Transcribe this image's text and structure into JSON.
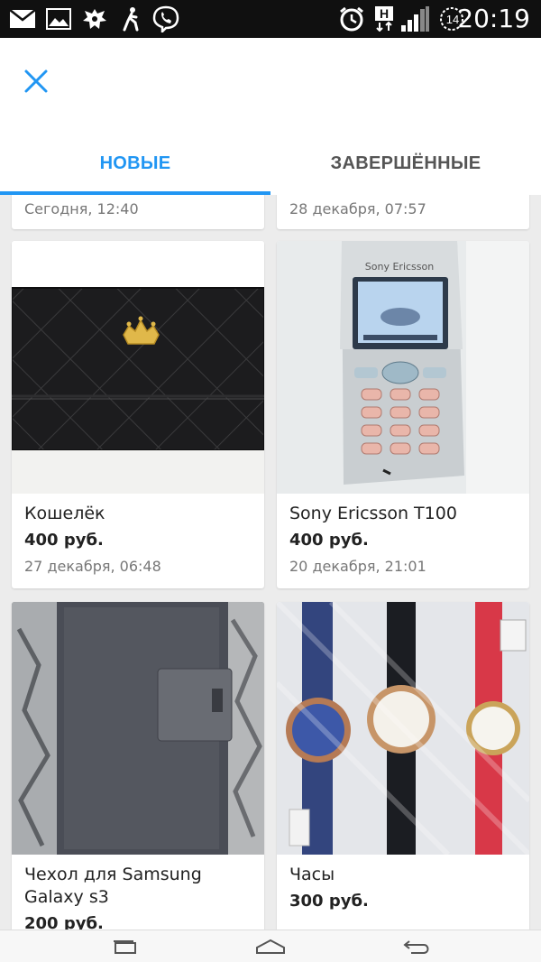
{
  "status_bar": {
    "time": "20:19",
    "signal_badge": "H",
    "notification_count": "14",
    "icons": [
      "mail-icon",
      "gallery-icon",
      "emblem-icon",
      "walking-icon",
      "viber-icon",
      "alarm-icon",
      "network-h-icon",
      "signal-icon",
      "clock-badge-icon"
    ]
  },
  "header": {
    "close_icon": "close-icon",
    "tabs": [
      {
        "label": "НОВЫЕ",
        "active": true
      },
      {
        "label": "ЗАВЕРШЁННЫЕ",
        "active": false
      }
    ],
    "accent_color": "#2196f3"
  },
  "listings_top": [
    {
      "date": "Сегодня, 12:40"
    },
    {
      "date": "28 декабря, 07:57"
    }
  ],
  "listings": [
    {
      "title": "Кошелёк",
      "price": "400 руб.",
      "date": "27 декабря, 06:48",
      "image": "wallet-photo"
    },
    {
      "title": "Sony Ericsson T100",
      "price": "400 руб.",
      "date": "20 декабря, 21:01",
      "image": "phone-photo",
      "brand_text": "Sony Ericsson"
    },
    {
      "title": "Чехол для Samsung Galaxy s3",
      "price": "200 руб.",
      "image": "case-photo"
    },
    {
      "title": "Часы",
      "price": "300 руб.",
      "image": "watches-photo"
    }
  ],
  "nav_bar": {
    "buttons": [
      "recent-apps-icon",
      "home-icon",
      "back-icon"
    ]
  }
}
